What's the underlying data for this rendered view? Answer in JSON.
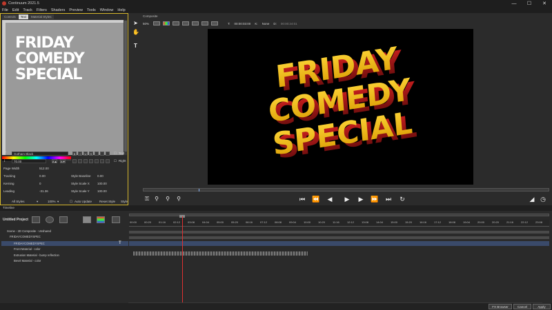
{
  "app": {
    "title": "Continuum 2021.5"
  },
  "window_controls": {
    "minimize": "—",
    "maximize": "☐",
    "close": "✕"
  },
  "menu": [
    "File",
    "Edit",
    "Track",
    "Filters",
    "Shaders",
    "Preview",
    "Tools",
    "Window",
    "Help"
  ],
  "left_panel": {
    "tabs": [
      "Controls",
      "Text",
      "Material Styles"
    ],
    "preview_text": "FRIDAY\nCOMEDY\nSPECIAL",
    "font_name": "Gotham Black",
    "font_size": "70.00",
    "align_buttons": [
      "A▲",
      "A▼"
    ],
    "style_buttons": [
      "B",
      "I",
      "U",
      "S"
    ],
    "text_label": "Text",
    "right_label": "Right",
    "page_width_label": "Page Width",
    "page_width_value": "512.00",
    "tracking_label": "Tracking",
    "tracking_value": "0.00",
    "kerning_label": "Kerning",
    "kerning_value": "0",
    "leading_label": "Leading",
    "leading_value": "-31.36",
    "style_baseline_label": "Style Baseline",
    "style_baseline_value": "0.00",
    "style_scale_x_label": "Style Scale X",
    "style_scale_x_value": "100.00",
    "style_scale_y_label": "Style Scale Y",
    "style_scale_y_value": "100.00",
    "all_styles_label": "All Styles",
    "zoom_value": "100%",
    "auto_update_label": "Auto Update",
    "reset_style_label": "Reset Style",
    "style_label": "Style"
  },
  "composite": {
    "label": "Composite",
    "zoom": "50%",
    "t_label": "T:",
    "t_value": "00:00:03:00",
    "k_label": "K:",
    "k_value": "None",
    "d_label": "D:",
    "d_value": "00:00:24:01",
    "viewer_text": [
      "FRIDAY",
      "COMEDY",
      "SPECIAL"
    ],
    "side_tools": [
      "select-arrow",
      "hand",
      "text-tool"
    ],
    "transport": [
      "key-icon",
      "goto-start",
      "step-back",
      "play-back",
      "play",
      "step-forward",
      "goto-end",
      "loop"
    ]
  },
  "timeline": {
    "label": "Timeline",
    "project_name": "Untitled Project",
    "tracks": [
      "Scene - 2D Composite - Unshared",
      "FRIDAYCOMEDYSPEC",
      "FRIDAYCOMEDYSPEC",
      "Front Material - color",
      "Extrusion Material - bump reflection",
      "Bevel Material - color"
    ],
    "ruler_ticks": [
      "00:00",
      "00:20",
      "01:16",
      "02:12",
      "03:08",
      "04:04",
      "05:00",
      "05:20",
      "06:16",
      "07:12",
      "08:08",
      "09:04",
      "10:00",
      "10:20",
      "11:16",
      "12:12",
      "13:08",
      "14:04",
      "15:00",
      "15:20",
      "16:16",
      "17:12",
      "18:08",
      "19:04",
      "20:00",
      "20:20",
      "21:16",
      "22:12",
      "23:08"
    ]
  },
  "bottom_buttons": {
    "fx_browser": "FX Browser",
    "cancel": "Cancel",
    "apply": "Apply"
  },
  "colors": {
    "accent_yellow": "#d8b92d",
    "title_gold": "#f2c400",
    "extrude_red": "#b01818",
    "playhead": "#e03030"
  }
}
